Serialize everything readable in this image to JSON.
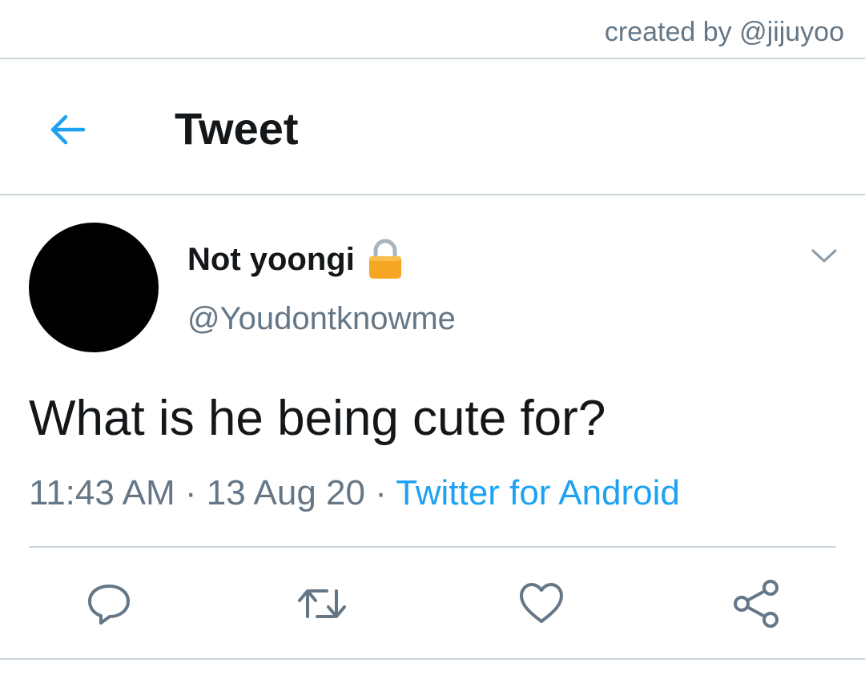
{
  "watermark": "created by @jijuyoo",
  "header": {
    "title": "Tweet",
    "back_icon": "arrow-left-icon"
  },
  "tweet": {
    "display_name": "Not yoongi",
    "protected_icon": "lock-icon",
    "handle": "@Youdontknowme",
    "text": "What is he being cute for?",
    "time": "11:43 AM",
    "separator": "·",
    "date": "13 Aug 20",
    "source": "Twitter for Android",
    "menu_icon": "chevron-down-icon"
  },
  "actions": {
    "reply_icon": "reply-icon",
    "retweet_icon": "retweet-icon",
    "like_icon": "heart-icon",
    "share_icon": "share-icon"
  },
  "colors": {
    "accent": "#1da1f2",
    "secondary_text": "#657786",
    "primary_text": "#14171a",
    "divider": "#ccd6dd",
    "lock": "#f5a623"
  }
}
